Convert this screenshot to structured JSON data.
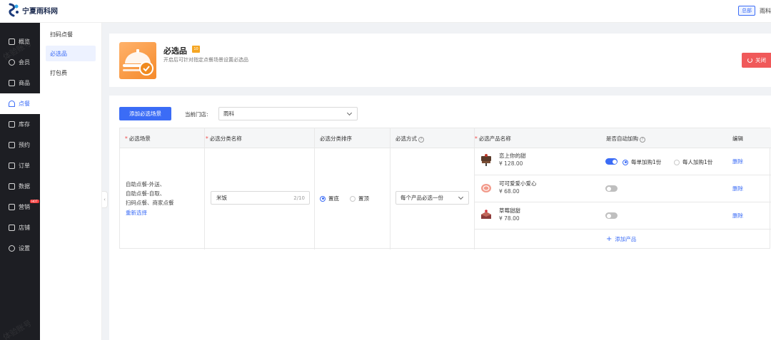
{
  "brand": {
    "name": "宁夏雨科网"
  },
  "topbar": {
    "badge": "总部",
    "store": "雨科"
  },
  "sidebar": {
    "items": [
      {
        "label": "概览",
        "icon": "dashboard-icon"
      },
      {
        "label": "会员",
        "icon": "member-icon"
      },
      {
        "label": "商品",
        "icon": "goods-icon"
      },
      {
        "label": "点餐",
        "icon": "order-food-icon",
        "active": true
      },
      {
        "label": "库存",
        "icon": "inventory-icon"
      },
      {
        "label": "预约",
        "icon": "reservation-icon"
      },
      {
        "label": "订单",
        "icon": "orders-icon"
      },
      {
        "label": "数据",
        "icon": "data-icon"
      },
      {
        "label": "营销",
        "icon": "marketing-icon",
        "badge": "HOT"
      },
      {
        "label": "店铺",
        "icon": "shop-icon"
      },
      {
        "label": "设置",
        "icon": "settings-icon"
      }
    ]
  },
  "subnav": {
    "items": [
      {
        "label": "扫码点餐"
      },
      {
        "label": "必选品",
        "active": true
      },
      {
        "label": "打包费"
      }
    ]
  },
  "header": {
    "title": "必选品",
    "badge": "10",
    "description": "开启后可针对指定点餐场景设置必选品",
    "close_label": "关闭"
  },
  "toolbar": {
    "add_scene_label": "添加必选场景",
    "store_label": "当前门店:",
    "store_value": "雨科"
  },
  "table": {
    "headers": {
      "scene": "必选场景",
      "category_name": "必选分类名称",
      "category_sort": "必选分类排序",
      "method": "必选方式",
      "product_name": "必选产品名称",
      "auto_add": "是否自动加购",
      "edit": "编辑"
    },
    "scene_lines": [
      "自助点餐-外送、",
      "自助点餐-自取、",
      "扫码点餐、商家点餐"
    ],
    "reselect_label": "重新选择",
    "category_value": "米饭",
    "category_count": "2/10",
    "sort_options": [
      {
        "label": "置底",
        "selected": true
      },
      {
        "label": "置顶",
        "selected": false
      }
    ],
    "method_value": "每个产品必选一份",
    "products": [
      {
        "name": "恋上你的甜",
        "price": "¥ 128.00",
        "auto": true
      },
      {
        "name": "可可爱爱小爱心",
        "price": "¥ 68.00",
        "auto": false
      },
      {
        "name": "草莓甜甜",
        "price": "¥ 78.00",
        "auto": false
      }
    ],
    "auto_options": [
      {
        "label": "每单加购1份",
        "selected": true
      },
      {
        "label": "每人加购1份",
        "selected": false
      }
    ],
    "delete_label": "删除",
    "add_product_label": "添加产品"
  },
  "watermark": {
    "text": "体验账号"
  },
  "colors": {
    "primary": "#3b6cf6",
    "danger": "#f0595a",
    "sidebar_bg": "#1d1e23"
  }
}
